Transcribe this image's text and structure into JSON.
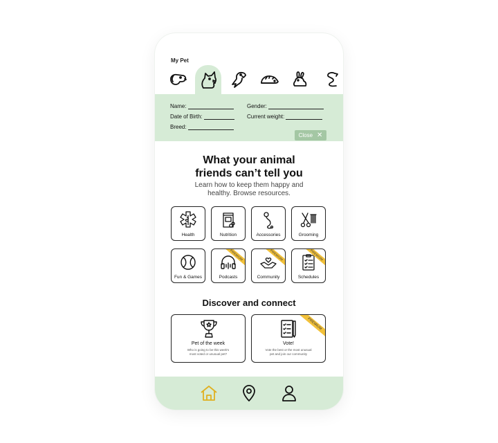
{
  "header": {
    "title": "My Pet"
  },
  "pet_tabs": [
    {
      "icon": "dog-icon",
      "active": false
    },
    {
      "icon": "cat-icon",
      "active": true
    },
    {
      "icon": "parrot-icon",
      "active": false
    },
    {
      "icon": "hedgehog-icon",
      "active": false
    },
    {
      "icon": "rabbit-icon",
      "active": false
    },
    {
      "icon": "snake-icon",
      "active": false
    }
  ],
  "form": {
    "name_label": "Name:",
    "gender_label": "Gender:",
    "dob_label": "Date of Birth:",
    "weight_label": "Current weight:",
    "breed_label": "Breed:",
    "close_label": "Close"
  },
  "hero": {
    "title_line1": "What your animal",
    "title_line2": "friends can’t tell you",
    "subtitle_line1": "Learn how to keep them happy and",
    "subtitle_line2": "healthy. Browse resources."
  },
  "resources": [
    {
      "label": "Health",
      "icon": "health-icon",
      "premium": false
    },
    {
      "label": "Nutrition",
      "icon": "food-bag-icon",
      "premium": false
    },
    {
      "label": "Accessories",
      "icon": "leash-icon",
      "premium": false
    },
    {
      "label": "Grooming",
      "icon": "scissors-comb-icon",
      "premium": false
    },
    {
      "label": "Fun & Games",
      "icon": "ball-icon",
      "premium": false
    },
    {
      "label": "Podcasts",
      "icon": "headphones-icon",
      "premium": true
    },
    {
      "label": "Community",
      "icon": "hands-heart-icon",
      "premium": true
    },
    {
      "label": "Schedules",
      "icon": "checklist-icon",
      "premium": true
    }
  ],
  "premium_label": "PREMIUM",
  "discover": {
    "title": "Discover and connect",
    "cards": [
      {
        "title": "Pet of the week",
        "desc_line1": "Who is going to be this week's",
        "desc_line2": "most voted or unusual pet?",
        "icon": "trophy-icon",
        "premium": false
      },
      {
        "title": "Vote!",
        "desc_line1": "Vote the best or the most unusual",
        "desc_line2": "pet and join our community",
        "icon": "ballot-icon",
        "premium": true
      }
    ]
  },
  "bottom_nav": [
    {
      "icon": "home-icon",
      "active": true
    },
    {
      "icon": "location-pin-icon",
      "active": false
    },
    {
      "icon": "profile-icon",
      "active": false
    }
  ],
  "colors": {
    "accent": "#d6ebd6",
    "button": "#a4c7a4",
    "premium": "#f2c13a",
    "active_nav": "#e0b020"
  }
}
